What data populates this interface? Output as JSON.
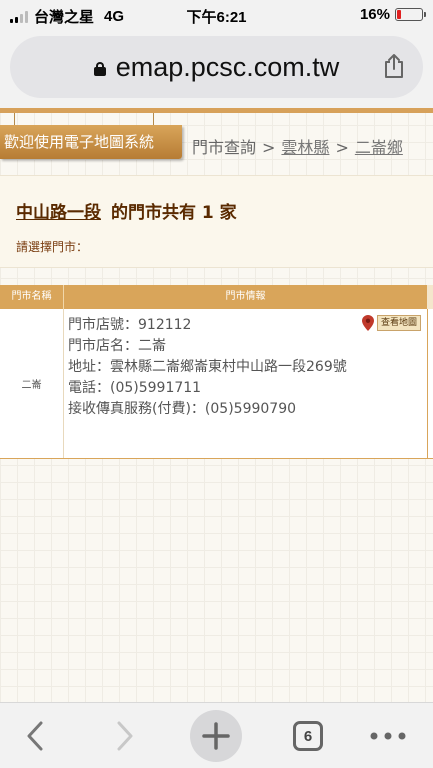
{
  "status_bar": {
    "carrier": "台灣之星",
    "network": "4G",
    "time": "下午6:21",
    "battery": "16%"
  },
  "browser": {
    "url": "emap.pcsc.com.tw",
    "tab_count": "6"
  },
  "site": {
    "welcome": "歡迎使用電子地圖系統",
    "breadcrumb": {
      "root": "門市查詢",
      "separator": ">",
      "county": "雲林縣",
      "township": "二崙鄉"
    }
  },
  "result": {
    "road": "中山路一段",
    "summary": "的門市共有 1 家",
    "prompt": "請選擇門市："
  },
  "table": {
    "headers": [
      "門市名稱",
      "門市情報"
    ],
    "rows": [
      {
        "name": "二崙",
        "store_id": "門市店號：912112",
        "store_name": "門市店名：二崙",
        "address": "地址：雲林縣二崙鄉崙東村中山路一段269號",
        "phone": "電話：(05)5991711",
        "fax": "接收傳真服務(付費)：(05)5990790",
        "map_button": "查看地圖"
      }
    ]
  },
  "colors": {
    "accent": "#d9a55a",
    "title_brown": "#5a2a00",
    "map_pin": "#c0392b"
  },
  "icons": {
    "lock": "lock-icon",
    "share": "share-icon",
    "back": "back-chevron-icon",
    "forward": "forward-chevron-icon",
    "new_tab": "plus-icon",
    "tabs": "tabs-icon",
    "more": "more-dots-icon"
  }
}
